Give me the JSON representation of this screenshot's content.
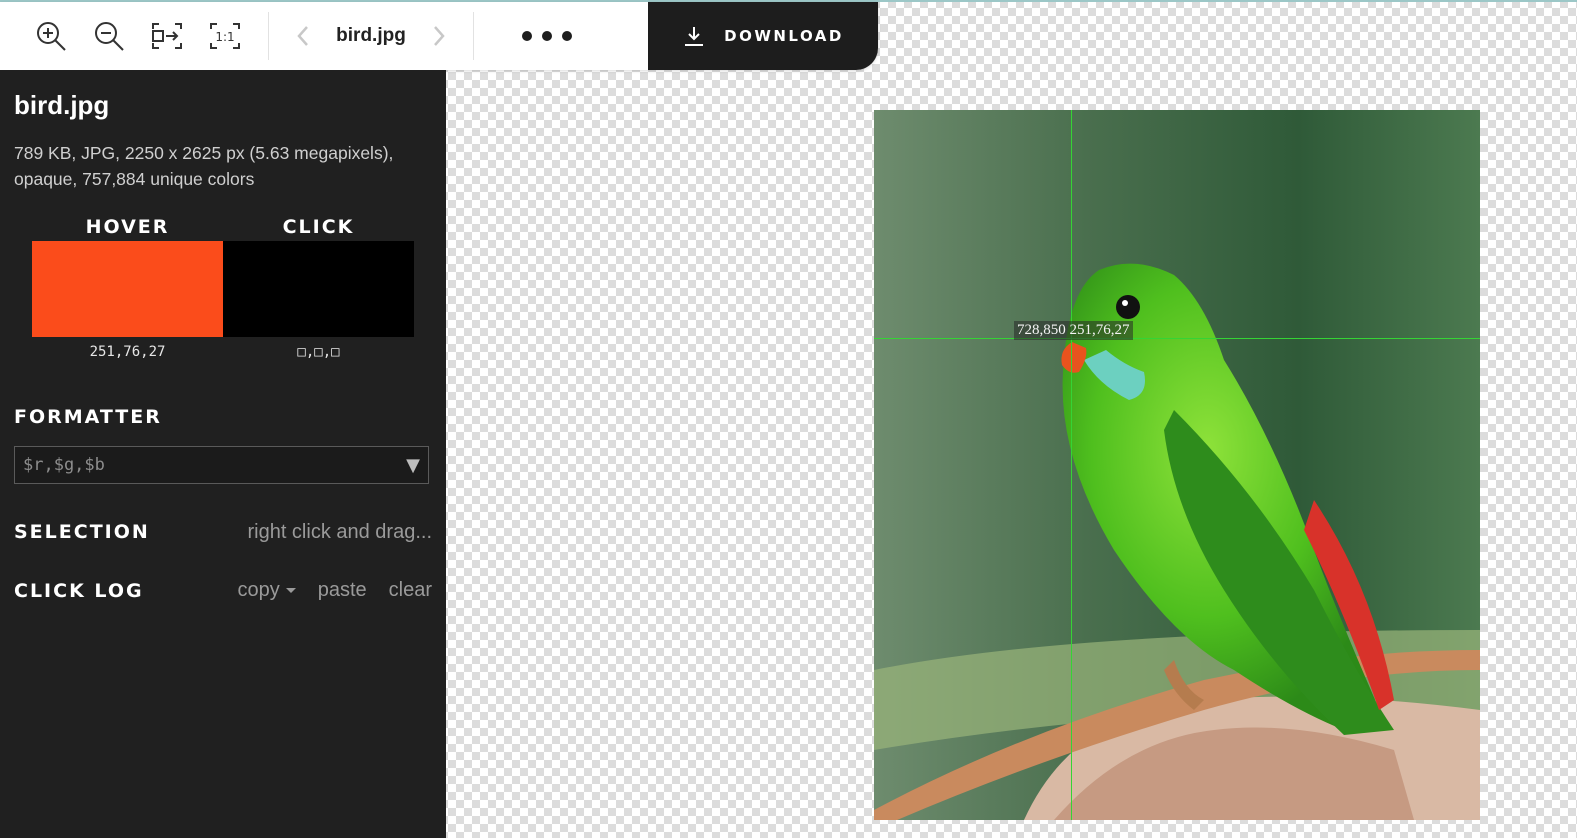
{
  "toolbar": {
    "zoom_in_icon": "zoom-in-icon",
    "zoom_out_icon": "zoom-out-icon",
    "fit_icon": "fit-to-screen-icon",
    "actual_size_label": "1:1",
    "filename": "bird.jpg",
    "download_label": "DOWNLOAD"
  },
  "sidebar": {
    "title": "bird.jpg",
    "info": "789 KB, JPG, 2250 x 2625 px (5.63 megapixels), opaque, 757,884 unique colors",
    "hover": {
      "label": "HOVER",
      "color": "#fb4c1b",
      "value": "251,76,27"
    },
    "click": {
      "label": "CLICK",
      "color": "#000000",
      "value": "□,□,□"
    },
    "formatter": {
      "label": "FORMATTER",
      "value": "$r,$g,$b"
    },
    "selection": {
      "label": "SELECTION",
      "hint": "right click and drag..."
    },
    "click_log": {
      "label": "CLICK LOG",
      "copy": "copy",
      "paste": "paste",
      "clear": "clear"
    }
  },
  "viewer": {
    "tooltip": "728,850 251,76,27",
    "crosshair_color": "#35d435"
  }
}
